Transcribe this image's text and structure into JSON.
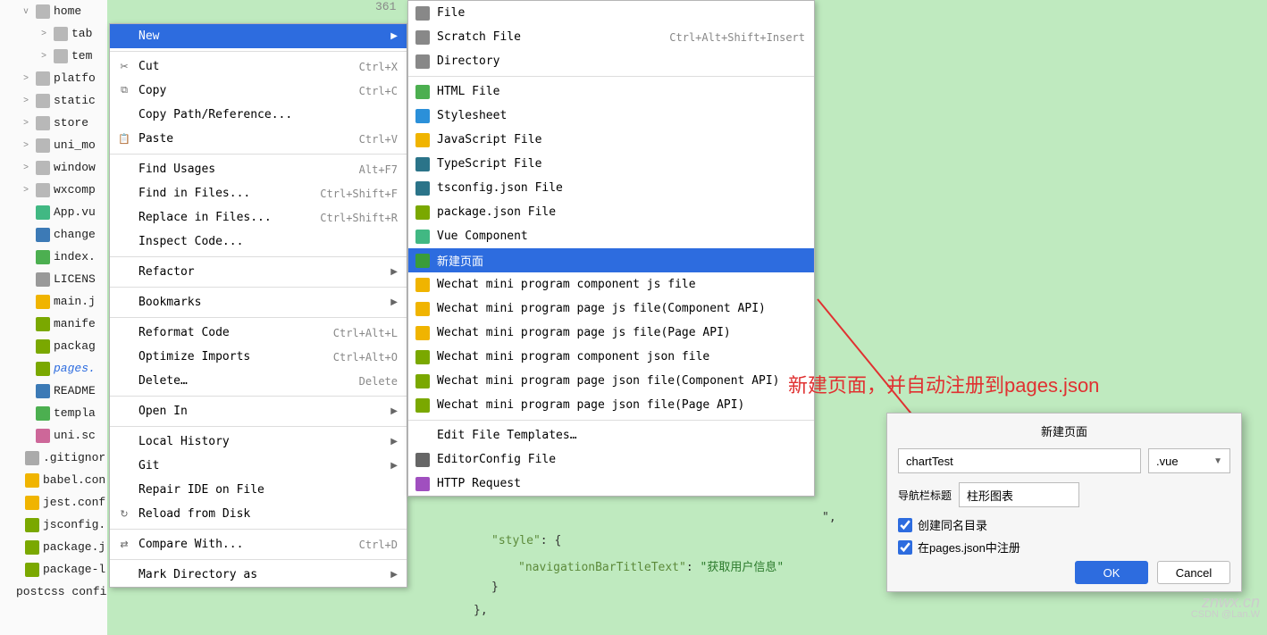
{
  "tree": {
    "items": [
      {
        "label": "home",
        "icon": "folder",
        "arrow": "v",
        "indent": "ind0"
      },
      {
        "label": "tab",
        "icon": "folder",
        "arrow": ">",
        "indent": "ind"
      },
      {
        "label": "tem",
        "icon": "folder",
        "arrow": ">",
        "indent": "ind"
      },
      {
        "label": "platfo",
        "icon": "folder",
        "arrow": ">",
        "indent": "ind0"
      },
      {
        "label": "static",
        "icon": "folder",
        "arrow": ">",
        "indent": "ind0"
      },
      {
        "label": "store",
        "icon": "folder",
        "arrow": ">",
        "indent": "ind0"
      },
      {
        "label": "uni_mo",
        "icon": "folder",
        "arrow": ">",
        "indent": "ind0"
      },
      {
        "label": "window",
        "icon": "folder",
        "arrow": ">",
        "indent": "ind0"
      },
      {
        "label": "wxcomp",
        "icon": "folder",
        "arrow": ">",
        "indent": "ind0"
      },
      {
        "label": "App.vu",
        "icon": "vue",
        "indent": "ind0"
      },
      {
        "label": "change",
        "icon": "md",
        "indent": "ind0"
      },
      {
        "label": "index.",
        "icon": "h",
        "indent": "ind0"
      },
      {
        "label": "LICENS",
        "icon": "txt",
        "indent": "ind0"
      },
      {
        "label": "main.j",
        "icon": "js",
        "indent": "ind0"
      },
      {
        "label": "manife",
        "icon": "json",
        "indent": "ind0"
      },
      {
        "label": "packag",
        "icon": "json",
        "indent": "ind0"
      },
      {
        "label": "pages.",
        "icon": "json",
        "indent": "ind0",
        "hl": true
      },
      {
        "label": "README",
        "icon": "md",
        "indent": "ind0"
      },
      {
        "label": "templa",
        "icon": "h",
        "indent": "ind0"
      },
      {
        "label": "uni.sc",
        "icon": "scss",
        "indent": "ind0"
      },
      {
        "label": ".gitignor",
        "icon": "generic",
        "indent": "ind0",
        "noicon": true,
        "lv": 1
      },
      {
        "label": "babel.con",
        "icon": "js",
        "indent": "ind0",
        "lv": 1
      },
      {
        "label": "jest.conf",
        "icon": "js",
        "indent": "ind0",
        "lv": 1
      },
      {
        "label": "jsconfig.",
        "icon": "json",
        "indent": "ind0",
        "lv": 1
      },
      {
        "label": "package.j",
        "icon": "json",
        "indent": "ind0",
        "lv": 1
      },
      {
        "label": "package-l",
        "icon": "json",
        "indent": "ind0",
        "lv": 1
      },
      {
        "label": "postcss config is",
        "icon": "js",
        "indent": "ind0",
        "lv": 1
      }
    ]
  },
  "editor": {
    "line_no": "361",
    "fragments": {
      "brace1": "}",
      "comma1": "\",",
      "styleKey": "\"style\"",
      "colon": ": {",
      "navKey": "\"navigationBarTitleText\"",
      "navColon": ":",
      "navVal": "\"获取用户信息\"",
      "closeBrace": "}",
      "closeObject": "},"
    }
  },
  "menu1": [
    {
      "label": "New",
      "shortcut": "",
      "sub": true,
      "selected": true
    },
    {
      "sep": true
    },
    {
      "label": "Cut",
      "shortcut": "Ctrl+X",
      "icon": "✂"
    },
    {
      "label": "Copy",
      "shortcut": "Ctrl+C",
      "icon": "⧉"
    },
    {
      "label": "Copy Path/Reference...",
      "shortcut": ""
    },
    {
      "label": "Paste",
      "shortcut": "Ctrl+V",
      "icon": "📋"
    },
    {
      "sep": true
    },
    {
      "label": "Find Usages",
      "shortcut": "Alt+F7"
    },
    {
      "label": "Find in Files...",
      "shortcut": "Ctrl+Shift+F"
    },
    {
      "label": "Replace in Files...",
      "shortcut": "Ctrl+Shift+R"
    },
    {
      "label": "Inspect Code...",
      "shortcut": ""
    },
    {
      "sep": true
    },
    {
      "label": "Refactor",
      "sub": true
    },
    {
      "sep": true
    },
    {
      "label": "Bookmarks",
      "sub": true
    },
    {
      "sep": true
    },
    {
      "label": "Reformat Code",
      "shortcut": "Ctrl+Alt+L"
    },
    {
      "label": "Optimize Imports",
      "shortcut": "Ctrl+Alt+O"
    },
    {
      "label": "Delete…",
      "shortcut": "Delete"
    },
    {
      "sep": true
    },
    {
      "label": "Open In",
      "sub": true
    },
    {
      "sep": true
    },
    {
      "label": "Local History",
      "sub": true
    },
    {
      "label": "Git",
      "sub": true
    },
    {
      "label": "Repair IDE on File"
    },
    {
      "label": "Reload from Disk",
      "icon": "↻"
    },
    {
      "sep": true
    },
    {
      "label": "Compare With...",
      "shortcut": "Ctrl+D",
      "icon": "⇄"
    },
    {
      "sep": true
    },
    {
      "label": "Mark Directory as",
      "sub": true
    }
  ],
  "menu2": [
    {
      "label": "File",
      "color": "#888"
    },
    {
      "label": "Scratch File",
      "color": "#888",
      "shortcut": "Ctrl+Alt+Shift+Insert"
    },
    {
      "label": "Directory",
      "color": "#888"
    },
    {
      "sep": true
    },
    {
      "label": "HTML File",
      "color": "#4caf50"
    },
    {
      "label": "Stylesheet",
      "color": "#2b90d9"
    },
    {
      "label": "JavaScript File",
      "color": "#f0b400"
    },
    {
      "label": "TypeScript File",
      "color": "#2b7489"
    },
    {
      "label": "tsconfig.json File",
      "color": "#2b7489"
    },
    {
      "label": "package.json File",
      "color": "#7aa800"
    },
    {
      "label": "Vue Component",
      "color": "#41b883"
    },
    {
      "label": "新建页面",
      "color": "#3a9c3a",
      "selected": true
    },
    {
      "label": "Wechat mini program component js file",
      "color": "#f0b400"
    },
    {
      "label": "Wechat mini program page js file(Component API)",
      "color": "#f0b400"
    },
    {
      "label": "Wechat mini program page js file(Page API)",
      "color": "#f0b400"
    },
    {
      "label": "Wechat mini program component json file",
      "color": "#7aa800"
    },
    {
      "label": "Wechat mini program page json file(Component API)",
      "color": "#7aa800"
    },
    {
      "label": "Wechat mini program page json file(Page API)",
      "color": "#7aa800"
    },
    {
      "sep": true
    },
    {
      "label": "Edit File Templates…"
    },
    {
      "label": "EditorConfig File",
      "color": "#666"
    },
    {
      "label": "HTTP Request",
      "color": "#a04fbf"
    }
  ],
  "annotation": "新建页面，并自动注册到pages.json",
  "dialog": {
    "title": "新建页面",
    "name_value": "chartTest",
    "ext": ".vue",
    "nav_label": "导航栏标题",
    "nav_value": "柱形图表",
    "check1": "创建同名目录",
    "check2": "在pages.json中注册",
    "ok": "OK",
    "cancel": "Cancel"
  },
  "watermark": {
    "brand": "znwx.cn",
    "credit": "CSDN @Lan.W"
  }
}
